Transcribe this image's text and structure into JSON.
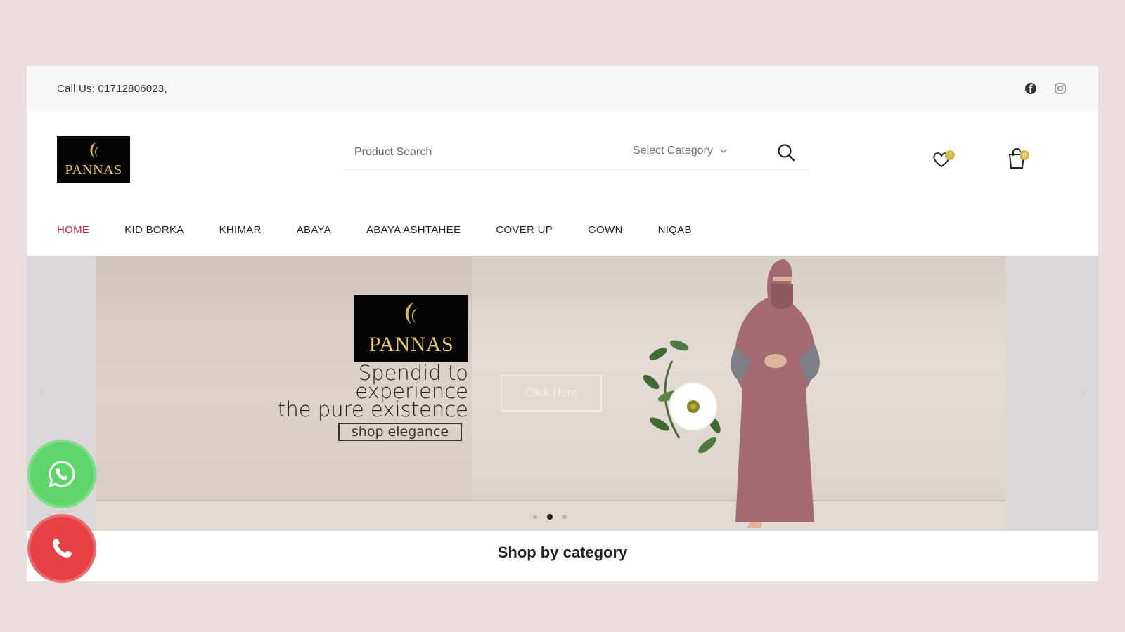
{
  "topbar": {
    "call_text": "Call Us: 01712806023,",
    "socials": [
      {
        "icon": "facebook-icon"
      },
      {
        "icon": "instagram-icon"
      }
    ]
  },
  "header": {
    "logo_text": "PANNAS",
    "search": {
      "placeholder": "Product Search",
      "category_label": "Select Category"
    },
    "wishlist_count": "0",
    "cart_count": "0"
  },
  "nav": {
    "items": [
      {
        "label": "HOME",
        "active": true
      },
      {
        "label": "KID BORKA"
      },
      {
        "label": "KHIMAR"
      },
      {
        "label": "ABAYA"
      },
      {
        "label": "ABAYA ASHTAHEE"
      },
      {
        "label": "COVER UP"
      },
      {
        "label": "GOWN"
      },
      {
        "label": "NIQAB"
      }
    ]
  },
  "hero": {
    "logo_text": "PANNAS",
    "tagline_line1": "Spendid to",
    "tagline_line2": "experience",
    "tagline_line3": "the pure existence",
    "shop_elegance": "shop elegance",
    "cta_label": "Click Here",
    "slide_count": 3,
    "active_slide": 2
  },
  "section_title": "Shop by category",
  "colors": {
    "accent_active_nav": "#c1283f",
    "logo_gold": "#e7c66d",
    "whatsapp_green": "#5fd56a",
    "phone_red": "#e64146"
  }
}
